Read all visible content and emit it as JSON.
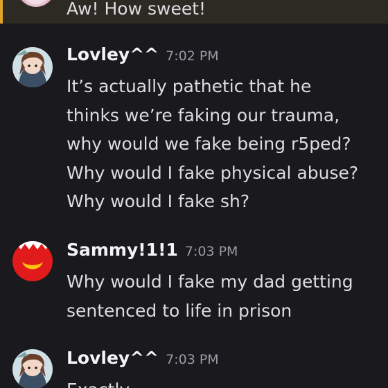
{
  "highlighted_message": {
    "text": "Aw! How sweet!"
  },
  "messages": [
    {
      "username": "Lovley^^",
      "timestamp": "7:02 PM",
      "avatar_icon": "anime-character-avatar",
      "lines": [
        "It’s actually pathetic that he",
        "thinks we’re faking our trauma,",
        "why would we fake being r5ped?",
        "Why would I fake physical abuse?",
        "Why would I fake sh?"
      ]
    },
    {
      "username": "Sammy!1!1",
      "timestamp": "7:03 PM",
      "avatar_icon": "happy-meal-box-avatar",
      "lines": [
        "Why would I fake my dad getting",
        "sentenced to life in prison"
      ]
    },
    {
      "username": "Lovley^^",
      "timestamp": "7:03 PM",
      "avatar_icon": "anime-character-avatar",
      "lines": [
        "Exactly"
      ]
    }
  ],
  "colors": {
    "background": "#1a1a1e",
    "mention_highlight": "#2c2a22",
    "mention_bar": "#e0a42a",
    "username": "#f2f3f5",
    "timestamp": "#9a9ba3",
    "message_text": "#dcdde1"
  }
}
